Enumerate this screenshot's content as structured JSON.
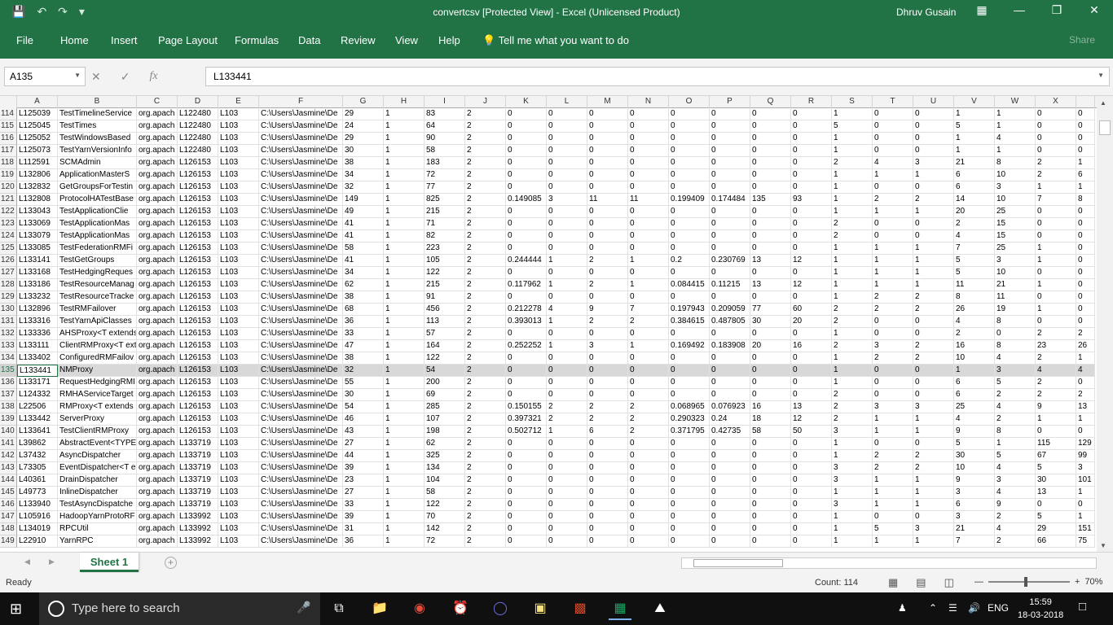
{
  "app": {
    "title": "convertcsv  [Protected View]  -  Excel (Unlicensed Product)",
    "user": "Dhruv Gusain"
  },
  "ribbon": {
    "tabs": [
      "File",
      "Home",
      "Insert",
      "Page Layout",
      "Formulas",
      "Data",
      "Review",
      "View",
      "Help"
    ],
    "tell_me": "Tell me what you want to do",
    "share": "Share"
  },
  "formula_bar": {
    "name_box": "A135",
    "fx": "fx",
    "value": "L133441"
  },
  "columns": [
    "A",
    "B",
    "C",
    "D",
    "E",
    "F",
    "G",
    "H",
    "I",
    "J",
    "K",
    "L",
    "M",
    "N",
    "O",
    "P",
    "Q",
    "R",
    "S",
    "T",
    "U",
    "V",
    "W",
    "X"
  ],
  "rows": [
    {
      "n": "114",
      "cells": [
        "L125039",
        "TestTimelineService",
        "org.apach",
        "L122480",
        "L103",
        "C:\\Users\\Jasmine\\De",
        "29",
        "1",
        "83",
        "2",
        "0",
        "0",
        "0",
        "0",
        "0",
        "0",
        "0",
        "0",
        "1",
        "0",
        "0",
        "1",
        "1",
        "0",
        "0"
      ]
    },
    {
      "n": "115",
      "cells": [
        "L125045",
        "TestTimes",
        "org.apach",
        "L122480",
        "L103",
        "C:\\Users\\Jasmine\\De",
        "24",
        "1",
        "64",
        "2",
        "0",
        "0",
        "0",
        "0",
        "0",
        "0",
        "0",
        "0",
        "5",
        "0",
        "0",
        "5",
        "1",
        "0",
        "0"
      ]
    },
    {
      "n": "116",
      "cells": [
        "L125052",
        "TestWindowsBased",
        "org.apach",
        "L122480",
        "L103",
        "C:\\Users\\Jasmine\\De",
        "29",
        "1",
        "90",
        "2",
        "0",
        "0",
        "0",
        "0",
        "0",
        "0",
        "0",
        "0",
        "1",
        "0",
        "0",
        "1",
        "4",
        "0",
        "0"
      ]
    },
    {
      "n": "117",
      "cells": [
        "L125073",
        "TestYarnVersionInfo",
        "org.apach",
        "L122480",
        "L103",
        "C:\\Users\\Jasmine\\De",
        "30",
        "1",
        "58",
        "2",
        "0",
        "0",
        "0",
        "0",
        "0",
        "0",
        "0",
        "0",
        "1",
        "0",
        "0",
        "1",
        "1",
        "0",
        "0"
      ]
    },
    {
      "n": "118",
      "cells": [
        "L112591",
        "SCMAdmin",
        "org.apach",
        "L126153",
        "L103",
        "C:\\Users\\Jasmine\\De",
        "38",
        "1",
        "183",
        "2",
        "0",
        "0",
        "0",
        "0",
        "0",
        "0",
        "0",
        "0",
        "2",
        "4",
        "3",
        "21",
        "8",
        "2",
        "1"
      ]
    },
    {
      "n": "119",
      "cells": [
        "L132806",
        "ApplicationMasterS",
        "org.apach",
        "L126153",
        "L103",
        "C:\\Users\\Jasmine\\De",
        "34",
        "1",
        "72",
        "2",
        "0",
        "0",
        "0",
        "0",
        "0",
        "0",
        "0",
        "0",
        "1",
        "1",
        "1",
        "6",
        "10",
        "2",
        "6"
      ]
    },
    {
      "n": "120",
      "cells": [
        "L132832",
        "GetGroupsForTestin",
        "org.apach",
        "L126153",
        "L103",
        "C:\\Users\\Jasmine\\De",
        "32",
        "1",
        "77",
        "2",
        "0",
        "0",
        "0",
        "0",
        "0",
        "0",
        "0",
        "0",
        "1",
        "0",
        "0",
        "6",
        "3",
        "1",
        "1"
      ]
    },
    {
      "n": "121",
      "cells": [
        "L132808",
        "ProtocolHATestBase",
        "org.apach",
        "L126153",
        "L103",
        "C:\\Users\\Jasmine\\De",
        "149",
        "1",
        "825",
        "2",
        "0.149085",
        "3",
        "11",
        "11",
        "0.199409",
        "0.174484",
        "135",
        "93",
        "1",
        "2",
        "2",
        "14",
        "10",
        "7",
        "8"
      ]
    },
    {
      "n": "122",
      "cells": [
        "L133043",
        "TestApplicationClie",
        "org.apach",
        "L126153",
        "L103",
        "C:\\Users\\Jasmine\\De",
        "49",
        "1",
        "215",
        "2",
        "0",
        "0",
        "0",
        "0",
        "0",
        "0",
        "0",
        "0",
        "1",
        "1",
        "1",
        "20",
        "25",
        "0",
        "0"
      ]
    },
    {
      "n": "123",
      "cells": [
        "L133069",
        "TestApplicationMas",
        "org.apach",
        "L126153",
        "L103",
        "C:\\Users\\Jasmine\\De",
        "41",
        "1",
        "71",
        "2",
        "0",
        "0",
        "0",
        "0",
        "0",
        "0",
        "0",
        "0",
        "2",
        "0",
        "0",
        "2",
        "15",
        "0",
        "0"
      ]
    },
    {
      "n": "124",
      "cells": [
        "L133079",
        "TestApplicationMas",
        "org.apach",
        "L126153",
        "L103",
        "C:\\Users\\Jasmine\\De",
        "41",
        "1",
        "82",
        "2",
        "0",
        "0",
        "0",
        "0",
        "0",
        "0",
        "0",
        "0",
        "2",
        "0",
        "0",
        "4",
        "15",
        "0",
        "0"
      ]
    },
    {
      "n": "125",
      "cells": [
        "L133085",
        "TestFederationRMFi",
        "org.apach",
        "L126153",
        "L103",
        "C:\\Users\\Jasmine\\De",
        "58",
        "1",
        "223",
        "2",
        "0",
        "0",
        "0",
        "0",
        "0",
        "0",
        "0",
        "0",
        "1",
        "1",
        "1",
        "7",
        "25",
        "1",
        "0"
      ]
    },
    {
      "n": "126",
      "cells": [
        "L133141",
        "TestGetGroups",
        "org.apach",
        "L126153",
        "L103",
        "C:\\Users\\Jasmine\\De",
        "41",
        "1",
        "105",
        "2",
        "0.244444",
        "1",
        "2",
        "1",
        "0.2",
        "0.230769",
        "13",
        "12",
        "1",
        "1",
        "1",
        "5",
        "3",
        "1",
        "0"
      ]
    },
    {
      "n": "127",
      "cells": [
        "L133168",
        "TestHedgingReques",
        "org.apach",
        "L126153",
        "L103",
        "C:\\Users\\Jasmine\\De",
        "34",
        "1",
        "122",
        "2",
        "0",
        "0",
        "0",
        "0",
        "0",
        "0",
        "0",
        "0",
        "1",
        "1",
        "1",
        "5",
        "10",
        "0",
        "0"
      ]
    },
    {
      "n": "128",
      "cells": [
        "L133186",
        "TestResourceManag",
        "org.apach",
        "L126153",
        "L103",
        "C:\\Users\\Jasmine\\De",
        "62",
        "1",
        "215",
        "2",
        "0.117962",
        "1",
        "2",
        "1",
        "0.084415",
        "0.11215",
        "13",
        "12",
        "1",
        "1",
        "1",
        "11",
        "21",
        "1",
        "0"
      ]
    },
    {
      "n": "129",
      "cells": [
        "L133232",
        "TestResourceTracke",
        "org.apach",
        "L126153",
        "L103",
        "C:\\Users\\Jasmine\\De",
        "38",
        "1",
        "91",
        "2",
        "0",
        "0",
        "0",
        "0",
        "0",
        "0",
        "0",
        "0",
        "1",
        "2",
        "2",
        "8",
        "11",
        "0",
        "0"
      ]
    },
    {
      "n": "130",
      "cells": [
        "L132896",
        "TestRMFailover",
        "org.apach",
        "L126153",
        "L103",
        "C:\\Users\\Jasmine\\De",
        "68",
        "1",
        "456",
        "2",
        "0.212278",
        "4",
        "9",
        "7",
        "0.197943",
        "0.209059",
        "77",
        "60",
        "2",
        "2",
        "2",
        "26",
        "19",
        "1",
        "0"
      ]
    },
    {
      "n": "131",
      "cells": [
        "L133316",
        "TestYarnApiClasses",
        "org.apach",
        "L126153",
        "L103",
        "C:\\Users\\Jasmine\\De",
        "36",
        "1",
        "113",
        "2",
        "0.393013",
        "1",
        "2",
        "2",
        "0.384615",
        "0.487805",
        "30",
        "20",
        "2",
        "0",
        "0",
        "4",
        "8",
        "0",
        "0"
      ]
    },
    {
      "n": "132",
      "cells": [
        "L133336",
        "AHSProxy<T extends",
        "org.apach",
        "L126153",
        "L103",
        "C:\\Users\\Jasmine\\De",
        "33",
        "1",
        "57",
        "2",
        "0",
        "0",
        "0",
        "0",
        "0",
        "0",
        "0",
        "0",
        "1",
        "0",
        "0",
        "2",
        "0",
        "2",
        "2"
      ]
    },
    {
      "n": "133",
      "cells": [
        "L133111",
        "ClientRMProxy<T ext",
        "org.apach",
        "L126153",
        "L103",
        "C:\\Users\\Jasmine\\De",
        "47",
        "1",
        "164",
        "2",
        "0.252252",
        "1",
        "3",
        "1",
        "0.169492",
        "0.183908",
        "20",
        "16",
        "2",
        "3",
        "2",
        "16",
        "8",
        "23",
        "26"
      ]
    },
    {
      "n": "134",
      "cells": [
        "L133402",
        "ConfiguredRMFailov",
        "org.apach",
        "L126153",
        "L103",
        "C:\\Users\\Jasmine\\De",
        "38",
        "1",
        "122",
        "2",
        "0",
        "0",
        "0",
        "0",
        "0",
        "0",
        "0",
        "0",
        "1",
        "2",
        "2",
        "10",
        "4",
        "2",
        "1"
      ]
    },
    {
      "n": "135",
      "cells": [
        "L133441",
        "NMProxy",
        "org.apach",
        "L126153",
        "L103",
        "C:\\Users\\Jasmine\\De",
        "32",
        "1",
        "54",
        "2",
        "0",
        "0",
        "0",
        "0",
        "0",
        "0",
        "0",
        "0",
        "1",
        "0",
        "0",
        "1",
        "3",
        "4",
        "4"
      ]
    },
    {
      "n": "136",
      "cells": [
        "L133171",
        "RequestHedgingRMI",
        "org.apach",
        "L126153",
        "L103",
        "C:\\Users\\Jasmine\\De",
        "55",
        "1",
        "200",
        "2",
        "0",
        "0",
        "0",
        "0",
        "0",
        "0",
        "0",
        "0",
        "1",
        "0",
        "0",
        "6",
        "5",
        "2",
        "0"
      ]
    },
    {
      "n": "137",
      "cells": [
        "L124332",
        "RMHAServiceTarget",
        "org.apach",
        "L126153",
        "L103",
        "C:\\Users\\Jasmine\\De",
        "30",
        "1",
        "69",
        "2",
        "0",
        "0",
        "0",
        "0",
        "0",
        "0",
        "0",
        "0",
        "2",
        "0",
        "0",
        "6",
        "2",
        "2",
        "2"
      ]
    },
    {
      "n": "138",
      "cells": [
        "L22506",
        "RMProxy<T extends",
        "org.apach",
        "L126153",
        "L103",
        "C:\\Users\\Jasmine\\De",
        "54",
        "1",
        "285",
        "2",
        "0.150155",
        "2",
        "2",
        "2",
        "0.068965",
        "0.076923",
        "16",
        "13",
        "2",
        "3",
        "3",
        "25",
        "4",
        "9",
        "13"
      ]
    },
    {
      "n": "139",
      "cells": [
        "L133442",
        "ServerProxy",
        "org.apach",
        "L126153",
        "L103",
        "C:\\Users\\Jasmine\\De",
        "46",
        "1",
        "107",
        "2",
        "0.397321",
        "2",
        "2",
        "2",
        "0.290323",
        "0.24",
        "18",
        "12",
        "2",
        "1",
        "1",
        "4",
        "2",
        "1",
        "1"
      ]
    },
    {
      "n": "140",
      "cells": [
        "L133641",
        "TestClientRMProxy",
        "org.apach",
        "L126153",
        "L103",
        "C:\\Users\\Jasmine\\De",
        "43",
        "1",
        "198",
        "2",
        "0.502712",
        "1",
        "6",
        "2",
        "0.371795",
        "0.42735",
        "58",
        "50",
        "3",
        "1",
        "1",
        "9",
        "8",
        "0",
        "0"
      ]
    },
    {
      "n": "141",
      "cells": [
        "L39862",
        "AbstractEvent<TYPE",
        "org.apach",
        "L133719",
        "L103",
        "C:\\Users\\Jasmine\\De",
        "27",
        "1",
        "62",
        "2",
        "0",
        "0",
        "0",
        "0",
        "0",
        "0",
        "0",
        "0",
        "1",
        "0",
        "0",
        "5",
        "1",
        "115",
        "129"
      ]
    },
    {
      "n": "142",
      "cells": [
        "L37432",
        "AsyncDispatcher",
        "org.apach",
        "L133719",
        "L103",
        "C:\\Users\\Jasmine\\De",
        "44",
        "1",
        "325",
        "2",
        "0",
        "0",
        "0",
        "0",
        "0",
        "0",
        "0",
        "0",
        "1",
        "2",
        "2",
        "30",
        "5",
        "67",
        "99"
      ]
    },
    {
      "n": "143",
      "cells": [
        "L73305",
        "EventDispatcher<T e",
        "org.apach",
        "L133719",
        "L103",
        "C:\\Users\\Jasmine\\De",
        "39",
        "1",
        "134",
        "2",
        "0",
        "0",
        "0",
        "0",
        "0",
        "0",
        "0",
        "0",
        "3",
        "2",
        "2",
        "10",
        "4",
        "5",
        "3"
      ]
    },
    {
      "n": "144",
      "cells": [
        "L40361",
        "DrainDispatcher",
        "org.apach",
        "L133719",
        "L103",
        "C:\\Users\\Jasmine\\De",
        "23",
        "1",
        "104",
        "2",
        "0",
        "0",
        "0",
        "0",
        "0",
        "0",
        "0",
        "0",
        "3",
        "1",
        "1",
        "9",
        "3",
        "30",
        "101"
      ]
    },
    {
      "n": "145",
      "cells": [
        "L49773",
        "InlineDispatcher",
        "org.apach",
        "L133719",
        "L103",
        "C:\\Users\\Jasmine\\De",
        "27",
        "1",
        "58",
        "2",
        "0",
        "0",
        "0",
        "0",
        "0",
        "0",
        "0",
        "0",
        "1",
        "1",
        "1",
        "3",
        "4",
        "13",
        "1"
      ]
    },
    {
      "n": "146",
      "cells": [
        "L133940",
        "TestAsyncDispatche",
        "org.apach",
        "L133719",
        "L103",
        "C:\\Users\\Jasmine\\De",
        "33",
        "1",
        "122",
        "2",
        "0",
        "0",
        "0",
        "0",
        "0",
        "0",
        "0",
        "0",
        "3",
        "1",
        "1",
        "6",
        "9",
        "0",
        "0"
      ]
    },
    {
      "n": "147",
      "cells": [
        "L105916",
        "HadoopYarnProtoRF",
        "org.apach",
        "L133992",
        "L103",
        "C:\\Users\\Jasmine\\De",
        "39",
        "1",
        "70",
        "2",
        "0",
        "0",
        "0",
        "0",
        "0",
        "0",
        "0",
        "0",
        "1",
        "0",
        "0",
        "3",
        "2",
        "5",
        "1"
      ]
    },
    {
      "n": "148",
      "cells": [
        "L134019",
        "RPCUtil",
        "org.apach",
        "L133992",
        "L103",
        "C:\\Users\\Jasmine\\De",
        "31",
        "1",
        "142",
        "2",
        "0",
        "0",
        "0",
        "0",
        "0",
        "0",
        "0",
        "0",
        "1",
        "5",
        "3",
        "21",
        "4",
        "29",
        "151"
      ]
    },
    {
      "n": "149",
      "cells": [
        "L22910",
        "YarnRPC",
        "org.apach",
        "L133992",
        "L103",
        "C:\\Users\\Jasmine\\De",
        "36",
        "1",
        "72",
        "2",
        "0",
        "0",
        "0",
        "0",
        "0",
        "0",
        "0",
        "0",
        "1",
        "1",
        "1",
        "7",
        "2",
        "66",
        "75"
      ]
    }
  ],
  "selected_row": "135",
  "sheet": {
    "tab": "Sheet 1"
  },
  "status": {
    "ready": "Ready",
    "count": "Count: 114",
    "zoom": "70%"
  },
  "taskbar": {
    "search_placeholder": "Type here to search",
    "lang": "ENG",
    "time": "15:59",
    "date": "18-03-2018"
  },
  "colors": {
    "excel_green": "#217346",
    "taskbar": "#101010"
  }
}
